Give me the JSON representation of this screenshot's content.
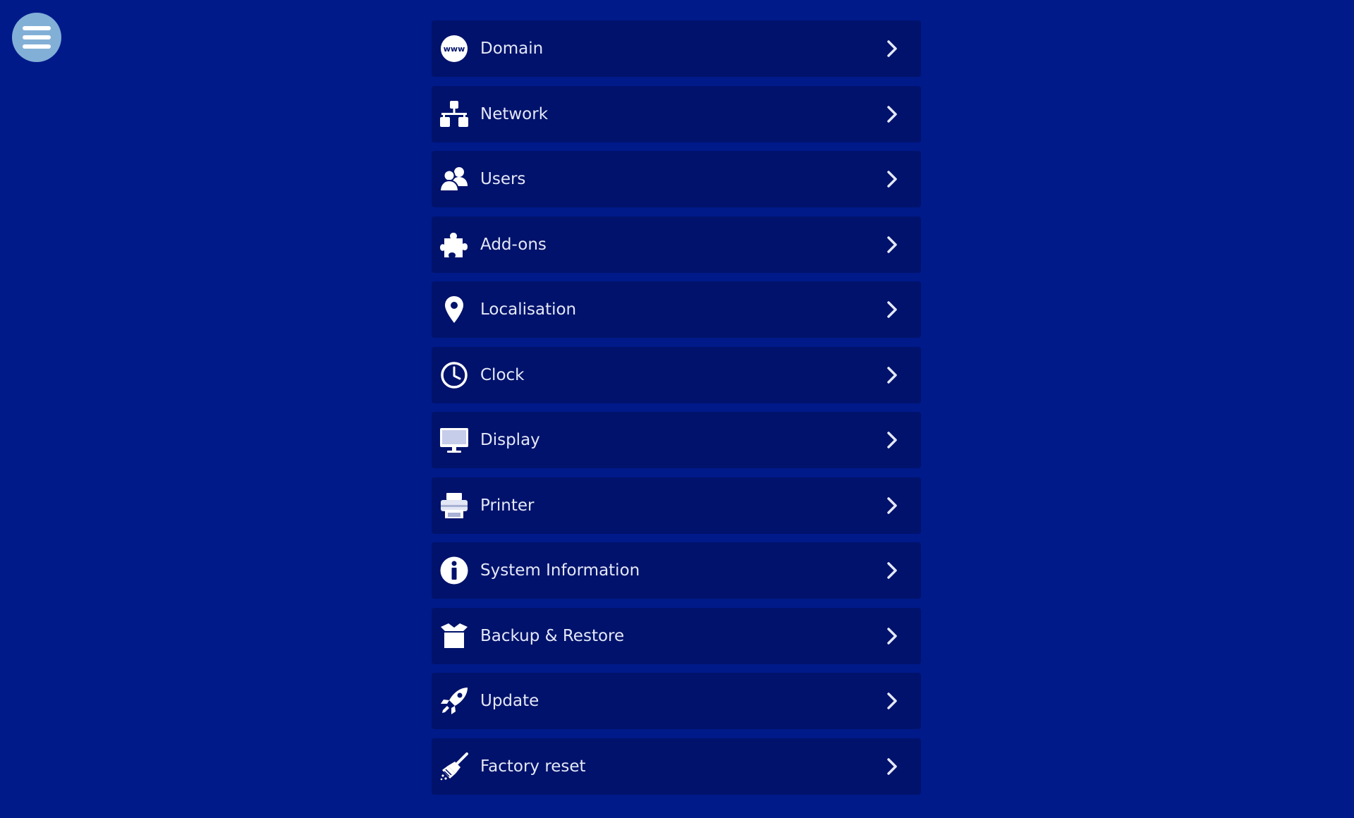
{
  "menu": {
    "icon": "hamburger-icon"
  },
  "colors": {
    "background": "#001a8a",
    "item_background": "#00126b",
    "menu_button": "#82afd6"
  },
  "items": [
    {
      "label": "Domain",
      "icon": "www-globe-icon",
      "icon_text": "www"
    },
    {
      "label": "Network",
      "icon": "network-icon"
    },
    {
      "label": "Users",
      "icon": "users-icon"
    },
    {
      "label": "Add-ons",
      "icon": "puzzle-piece-icon"
    },
    {
      "label": "Localisation",
      "icon": "map-pin-icon"
    },
    {
      "label": "Clock",
      "icon": "clock-icon"
    },
    {
      "label": "Display",
      "icon": "monitor-icon"
    },
    {
      "label": "Printer",
      "icon": "printer-icon"
    },
    {
      "label": "System Information",
      "icon": "info-icon"
    },
    {
      "label": "Backup & Restore",
      "icon": "box-icon"
    },
    {
      "label": "Update",
      "icon": "rocket-icon"
    },
    {
      "label": "Factory reset",
      "icon": "broom-icon"
    }
  ]
}
